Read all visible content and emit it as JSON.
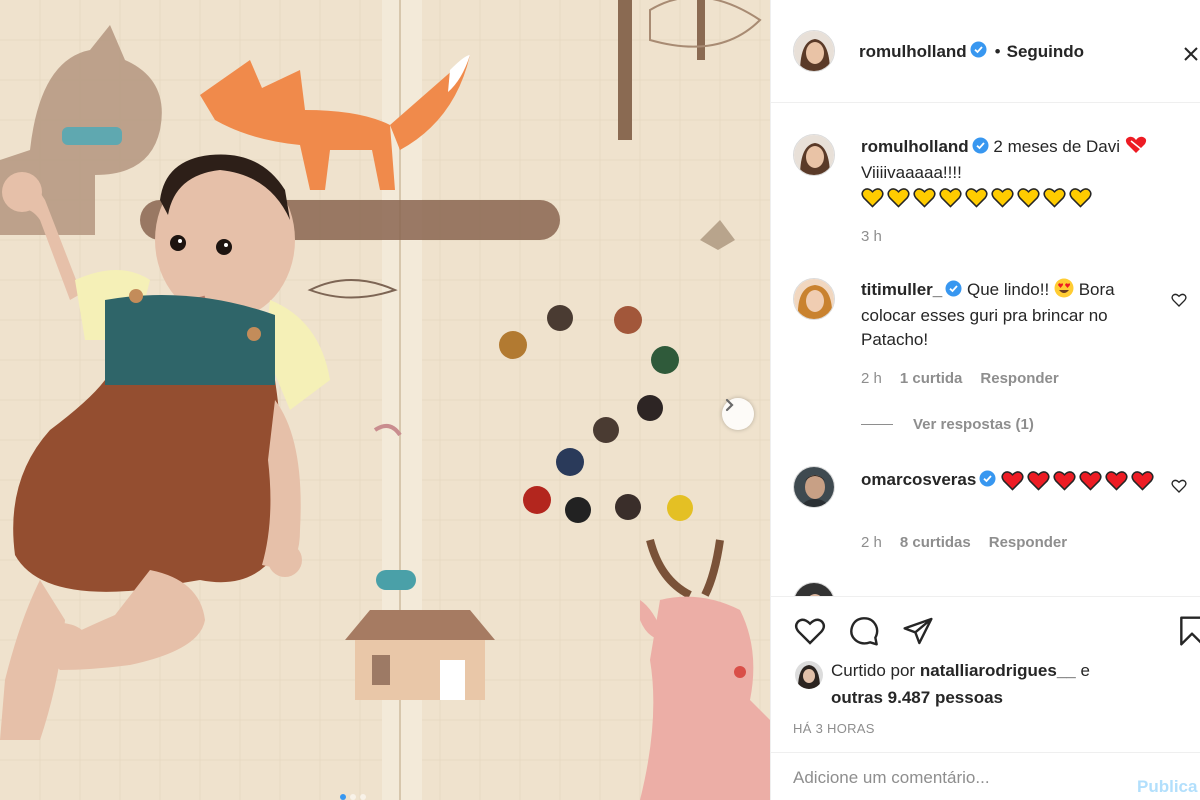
{
  "post": {
    "author": "romulholland",
    "follow_separator": "•",
    "follow_status": "Seguindo"
  },
  "comments": [
    {
      "username": "romulholland",
      "text": "2 meses de Davi",
      "text_line2": "Viiiivaaaaa!!!!",
      "emoji_count": 9,
      "time": "3 h"
    },
    {
      "username": "titimuller_",
      "text": "Que lindo!!",
      "text_rest": "Bora colocar esses guri pra brincar no Patacho!",
      "time": "2 h",
      "likes": "1 curtida",
      "reply": "Responder",
      "view_replies": "Ver respostas (1)"
    },
    {
      "username": "omarcosveras",
      "hearts": 6,
      "time": "2 h",
      "likes": "8 curtidas",
      "reply": "Responder"
    }
  ],
  "likes": {
    "prefix": "Curtido por",
    "user": "natalliarodrigues__",
    "conj": "e",
    "others": "outras 9.487 pessoas"
  },
  "timestamp": "HÁ 3 HORAS",
  "add_comment": {
    "placeholder": "Adicione um comentário...",
    "publish": "Publica"
  },
  "colors": {
    "verified": "#3897f0",
    "link_disabled": "#b2dffc",
    "secondary_text": "#8e8e8e",
    "heart_red": "#ed1c24",
    "yellow_heart": "#ffcc00"
  }
}
